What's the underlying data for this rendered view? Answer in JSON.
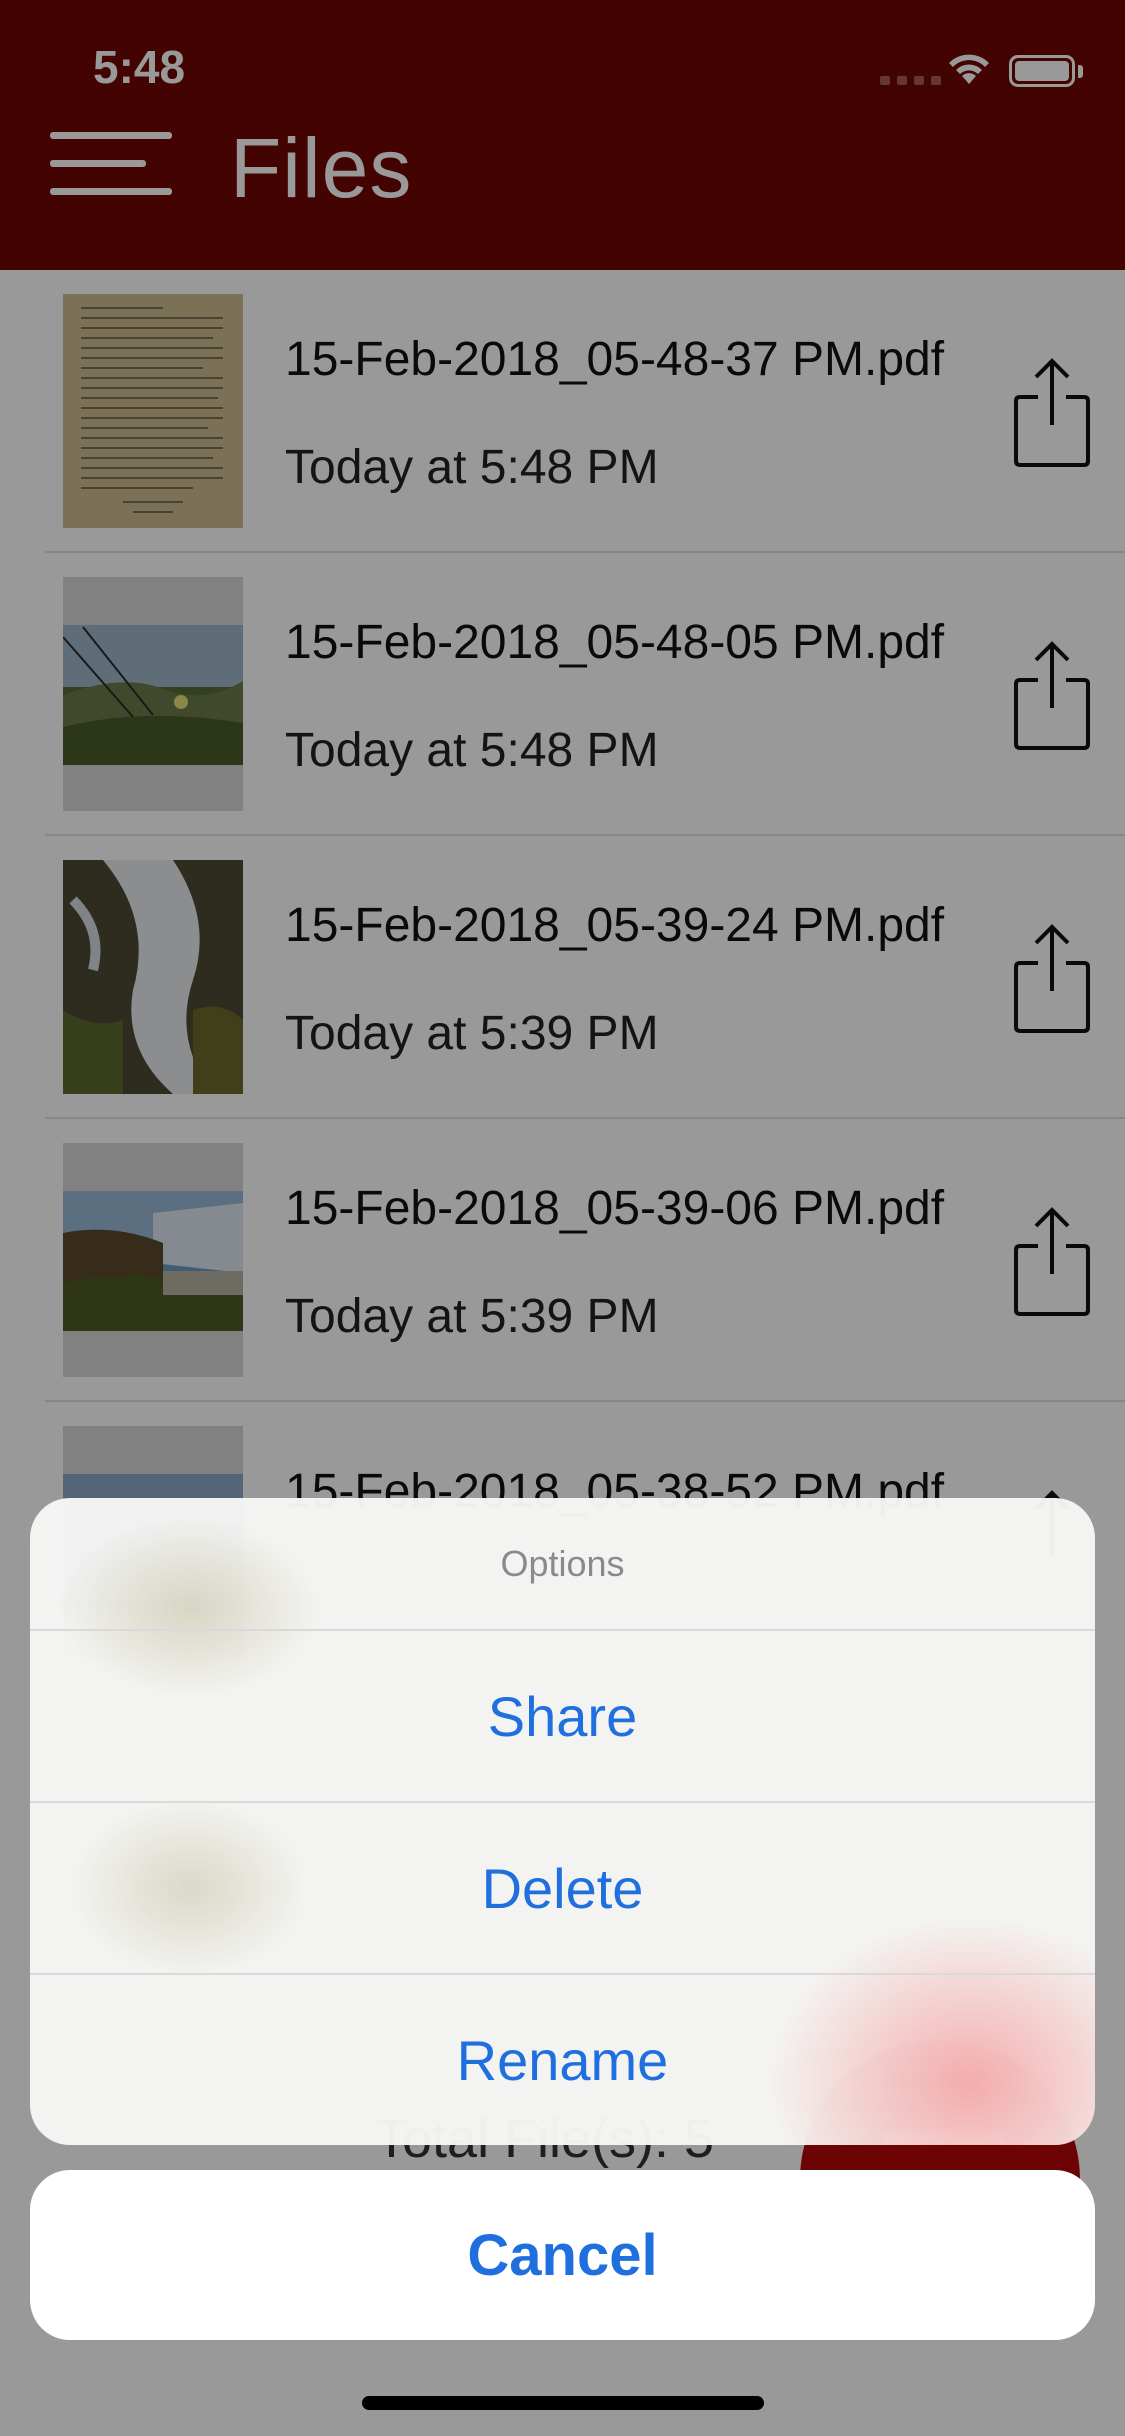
{
  "status_bar": {
    "time": "5:48"
  },
  "header": {
    "title": "Files"
  },
  "files": [
    {
      "name": "15-Feb-2018_05-48-37 PM.pdf",
      "date": "Today at 5:48 PM",
      "thumb": "document"
    },
    {
      "name": "15-Feb-2018_05-48-05 PM.pdf",
      "date": "Today at 5:48 PM",
      "thumb": "grass"
    },
    {
      "name": "15-Feb-2018_05-39-24 PM.pdf",
      "date": "Today at 5:39 PM",
      "thumb": "waterfall"
    },
    {
      "name": "15-Feb-2018_05-39-06 PM.pdf",
      "date": "Today at 5:39 PM",
      "thumb": "falls-landscape"
    },
    {
      "name": "15-Feb-2018_05-38-52 PM.pdf",
      "date": "",
      "thumb": "landscape"
    }
  ],
  "footer": {
    "total_label": "Total File(s): 5"
  },
  "action_sheet": {
    "title": "Options",
    "actions": [
      "Share",
      "Delete",
      "Rename"
    ],
    "cancel": "Cancel"
  },
  "colors": {
    "header_bg": "#6e0502",
    "accent_blue": "#1f6fde",
    "fab_red": "#b4080a"
  }
}
